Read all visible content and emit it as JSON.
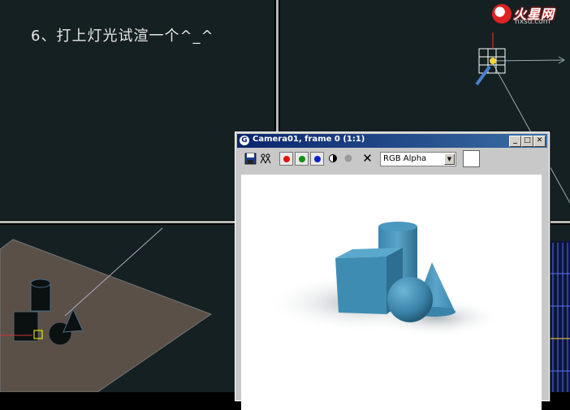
{
  "caption": "6、打上灯光试渲一个^_^",
  "logo": {
    "main": "火星网",
    "sub": "hxsd.com"
  },
  "render_window": {
    "title": "Camera01, frame 0 (1:1)",
    "title_icon": "max-icon",
    "buttons": {
      "minimize": "_",
      "maximize": "□",
      "close": "✕"
    },
    "toolbar": {
      "save_icon": "save-icon",
      "clone_icon": "clone-icon",
      "channels": [
        {
          "name": "red",
          "color": "#e01010"
        },
        {
          "name": "green",
          "color": "#109010"
        },
        {
          "name": "blue",
          "color": "#1020c8"
        }
      ],
      "clear_glyph": "✕",
      "channel_select": "RGB Alpha",
      "swatch_color": "#ffffff"
    }
  },
  "colors": {
    "viewport_bg": "#152022",
    "divider": "#b9b9b9",
    "object_blue": "#3f8cb0",
    "ground_plane": "#5a5048"
  }
}
